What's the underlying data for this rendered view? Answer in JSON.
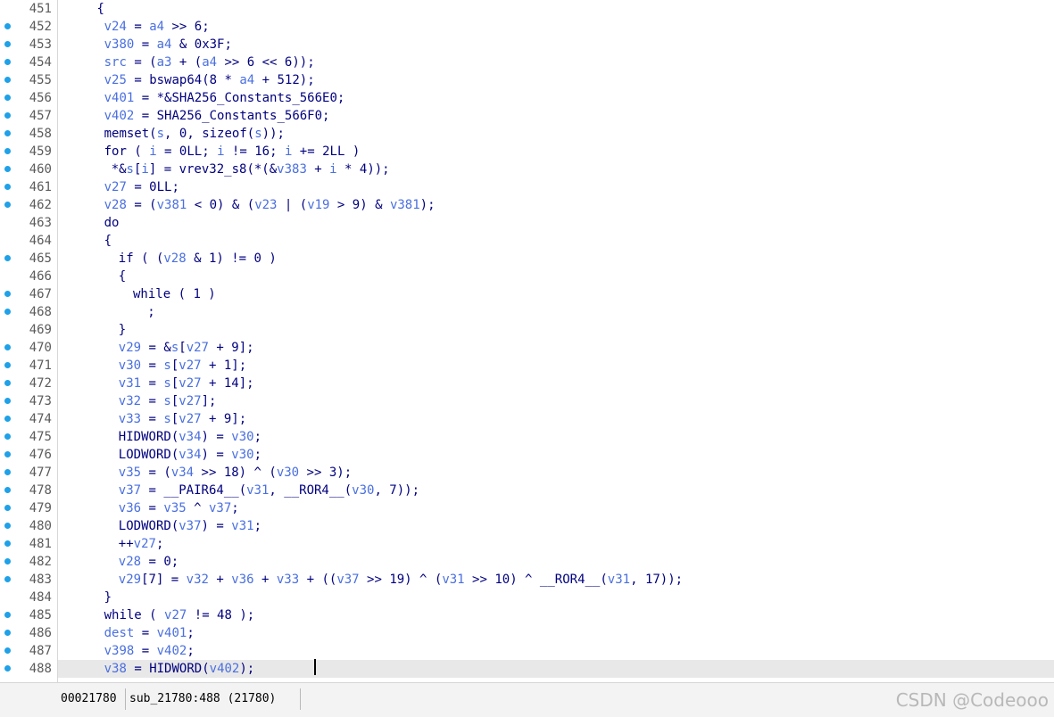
{
  "lines": [
    {
      "num": "451",
      "dot": false,
      "indent": 5,
      "code": "{"
    },
    {
      "num": "452",
      "dot": true,
      "indent": 6,
      "code": "v24 = a4 >> 6;"
    },
    {
      "num": "453",
      "dot": true,
      "indent": 6,
      "code": "v380 = a4 & 0x3F;"
    },
    {
      "num": "454",
      "dot": true,
      "indent": 6,
      "code": "src = (a3 + (a4 >> 6 << 6));"
    },
    {
      "num": "455",
      "dot": true,
      "indent": 6,
      "code": "v25 = bswap64(8 * a4 + 512);"
    },
    {
      "num": "456",
      "dot": true,
      "indent": 6,
      "code": "v401 = *&SHA256_Constants_566E0;"
    },
    {
      "num": "457",
      "dot": true,
      "indent": 6,
      "code": "v402 = SHA256_Constants_566F0;"
    },
    {
      "num": "458",
      "dot": true,
      "indent": 6,
      "code": "memset(s, 0, sizeof(s));"
    },
    {
      "num": "459",
      "dot": true,
      "indent": 6,
      "code": "for ( i = 0LL; i != 16; i += 2LL )"
    },
    {
      "num": "460",
      "dot": true,
      "indent": 7,
      "code": "*&s[i] = vrev32_s8(*(&v383 + i * 4));"
    },
    {
      "num": "461",
      "dot": true,
      "indent": 6,
      "code": "v27 = 0LL;"
    },
    {
      "num": "462",
      "dot": true,
      "indent": 6,
      "code": "v28 = (v381 < 0) & (v23 | (v19 > 9) & v381);"
    },
    {
      "num": "463",
      "dot": false,
      "indent": 6,
      "code": "do"
    },
    {
      "num": "464",
      "dot": false,
      "indent": 6,
      "code": "{"
    },
    {
      "num": "465",
      "dot": true,
      "indent": 8,
      "code": "if ( (v28 & 1) != 0 )"
    },
    {
      "num": "466",
      "dot": false,
      "indent": 8,
      "code": "{"
    },
    {
      "num": "467",
      "dot": true,
      "indent": 10,
      "code": "while ( 1 )"
    },
    {
      "num": "468",
      "dot": true,
      "indent": 12,
      "code": ";"
    },
    {
      "num": "469",
      "dot": false,
      "indent": 8,
      "code": "}"
    },
    {
      "num": "470",
      "dot": true,
      "indent": 8,
      "code": "v29 = &s[v27 + 9];"
    },
    {
      "num": "471",
      "dot": true,
      "indent": 8,
      "code": "v30 = s[v27 + 1];"
    },
    {
      "num": "472",
      "dot": true,
      "indent": 8,
      "code": "v31 = s[v27 + 14];"
    },
    {
      "num": "473",
      "dot": true,
      "indent": 8,
      "code": "v32 = s[v27];"
    },
    {
      "num": "474",
      "dot": true,
      "indent": 8,
      "code": "v33 = s[v27 + 9];"
    },
    {
      "num": "475",
      "dot": true,
      "indent": 8,
      "code": "HIDWORD(v34) = v30;"
    },
    {
      "num": "476",
      "dot": true,
      "indent": 8,
      "code": "LODWORD(v34) = v30;"
    },
    {
      "num": "477",
      "dot": true,
      "indent": 8,
      "code": "v35 = (v34 >> 18) ^ (v30 >> 3);"
    },
    {
      "num": "478",
      "dot": true,
      "indent": 8,
      "code": "v37 = __PAIR64__(v31, __ROR4__(v30, 7));"
    },
    {
      "num": "479",
      "dot": true,
      "indent": 8,
      "code": "v36 = v35 ^ v37;"
    },
    {
      "num": "480",
      "dot": true,
      "indent": 8,
      "code": "LODWORD(v37) = v31;"
    },
    {
      "num": "481",
      "dot": true,
      "indent": 8,
      "code": "++v27;"
    },
    {
      "num": "482",
      "dot": true,
      "indent": 8,
      "code": "v28 = 0;"
    },
    {
      "num": "483",
      "dot": true,
      "indent": 8,
      "code": "v29[7] = v32 + v36 + v33 + ((v37 >> 19) ^ (v31 >> 10) ^ __ROR4__(v31, 17));"
    },
    {
      "num": "484",
      "dot": false,
      "indent": 6,
      "code": "}"
    },
    {
      "num": "485",
      "dot": true,
      "indent": 6,
      "code": "while ( v27 != 48 );"
    },
    {
      "num": "486",
      "dot": true,
      "indent": 6,
      "code": "dest = v401;"
    },
    {
      "num": "487",
      "dot": true,
      "indent": 6,
      "code": "v398 = v402;"
    },
    {
      "num": "488",
      "dot": true,
      "indent": 6,
      "code": "v38 = HIDWORD(v402);",
      "current": true
    }
  ],
  "vars": [
    "v24",
    "a4",
    "v380",
    "src",
    "a3",
    "v25",
    "v401",
    "v402",
    "s",
    "i",
    "v383",
    "v27",
    "v28",
    "v381",
    "v23",
    "v19",
    "v29",
    "v30",
    "v31",
    "v32",
    "v33",
    "v34",
    "v35",
    "v37",
    "v36",
    "dest",
    "v398",
    "v38"
  ],
  "status": {
    "address": "00021780",
    "location": "sub_21780:488 (21780)"
  },
  "watermark": "CSDN @Codeooo",
  "colors": {
    "dot": "#1ea1e8",
    "variable": "#4a6fe0",
    "code": "#00007f",
    "current_line": "#e8e8e8"
  }
}
